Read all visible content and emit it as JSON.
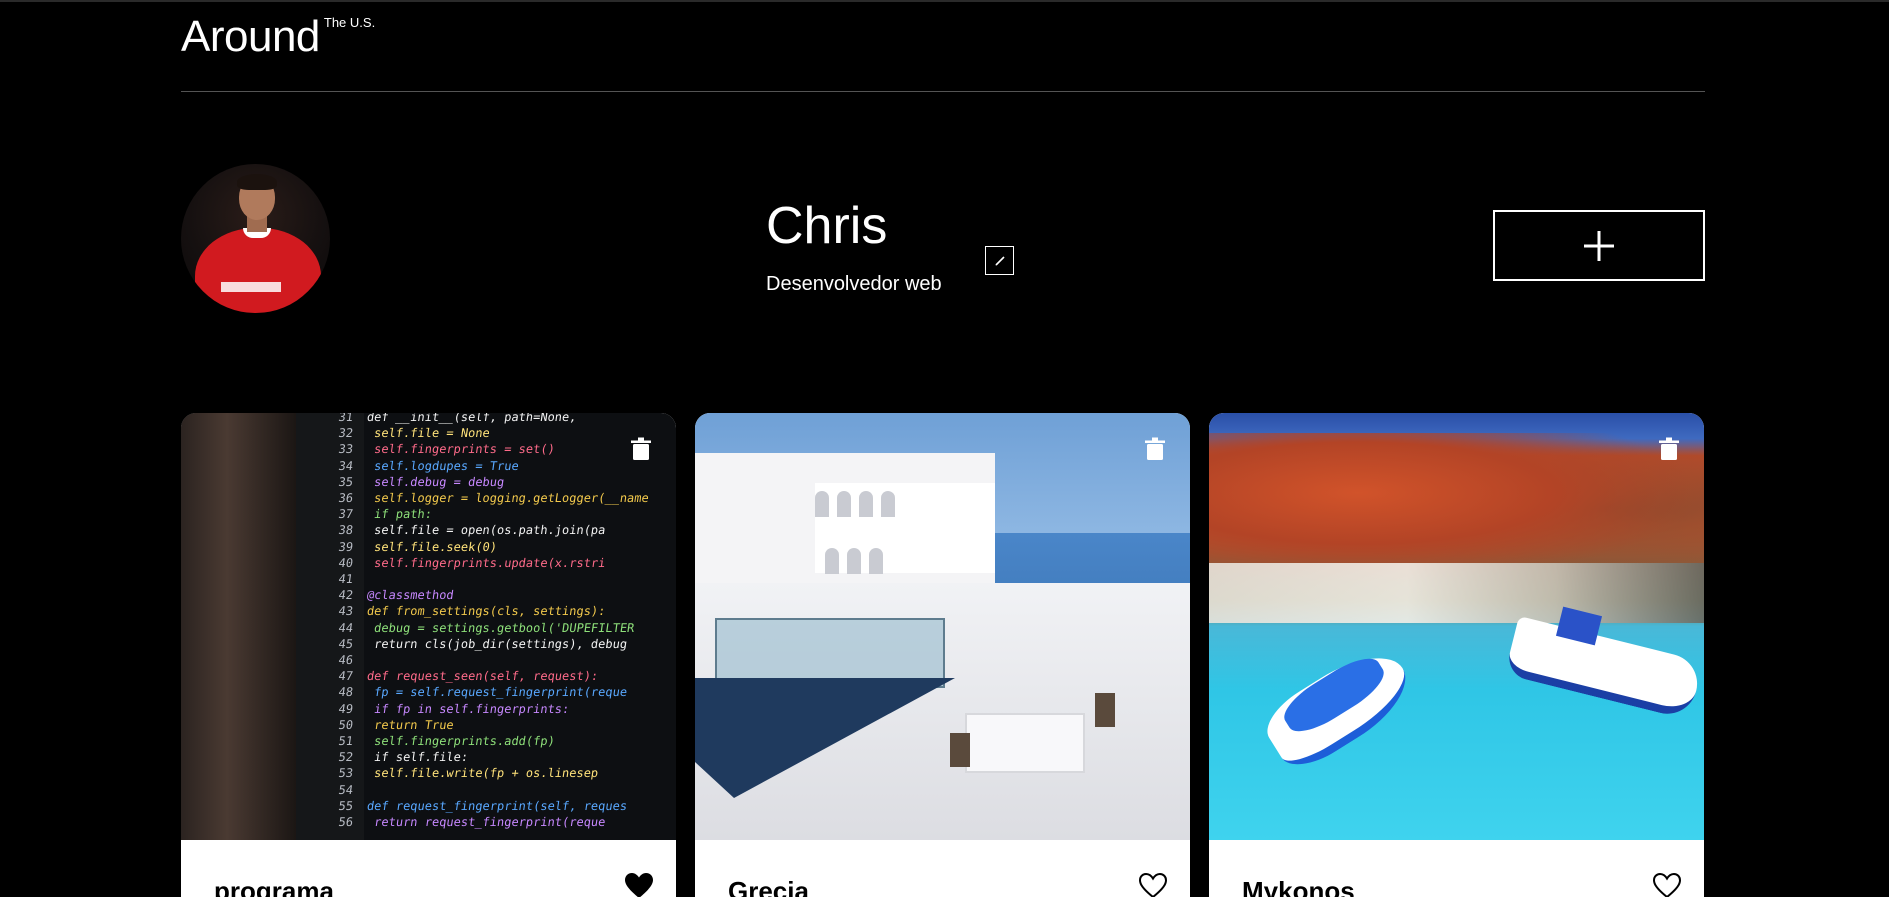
{
  "header": {
    "logo": "Around",
    "logo_sup": "The U.S."
  },
  "profile": {
    "name": "Chris",
    "about": "Desenvolvedor web",
    "avatar_alt": "profile avatar"
  },
  "cards": [
    {
      "title": "programa",
      "liked": true,
      "image": "code-on-screen"
    },
    {
      "title": "Grecia",
      "liked": false,
      "image": "white-buildings-santorini"
    },
    {
      "title": "Mykonos",
      "liked": false,
      "image": "boats-turquoise-bay"
    }
  ],
  "code_sample": [
    {
      "n": "31",
      "t": "def __init__(self, path=None,"
    },
    {
      "n": "32",
      "t": "    self.file = None"
    },
    {
      "n": "33",
      "t": "    self.fingerprints = set()"
    },
    {
      "n": "34",
      "t": "    self.logdupes = True"
    },
    {
      "n": "35",
      "t": "    self.debug = debug"
    },
    {
      "n": "36",
      "t": "    self.logger = logging.getLogger(__name"
    },
    {
      "n": "37",
      "t": "    if path:"
    },
    {
      "n": "38",
      "t": "        self.file = open(os.path.join(pa"
    },
    {
      "n": "39",
      "t": "        self.file.seek(0)"
    },
    {
      "n": "40",
      "t": "        self.fingerprints.update(x.rstri"
    },
    {
      "n": "41",
      "t": ""
    },
    {
      "n": "42",
      "t": "@classmethod"
    },
    {
      "n": "43",
      "t": "def from_settings(cls, settings):"
    },
    {
      "n": "44",
      "t": "    debug = settings.getbool('DUPEFILTER"
    },
    {
      "n": "45",
      "t": "    return cls(job_dir(settings), debug"
    },
    {
      "n": "46",
      "t": ""
    },
    {
      "n": "47",
      "t": "def request_seen(self, request):"
    },
    {
      "n": "48",
      "t": "    fp = self.request_fingerprint(reque"
    },
    {
      "n": "49",
      "t": "    if fp in self.fingerprints:"
    },
    {
      "n": "50",
      "t": "        return True"
    },
    {
      "n": "51",
      "t": "    self.fingerprints.add(fp)"
    },
    {
      "n": "52",
      "t": "    if self.file:"
    },
    {
      "n": "53",
      "t": "        self.file.write(fp + os.linesep"
    },
    {
      "n": "54",
      "t": ""
    },
    {
      "n": "55",
      "t": "def request_fingerprint(self, reques"
    },
    {
      "n": "56",
      "t": "    return request_fingerprint(reque"
    }
  ],
  "colors": {
    "background": "#000000",
    "text": "#ffffff",
    "card_bg": "#ffffff",
    "divider": "#545454"
  }
}
